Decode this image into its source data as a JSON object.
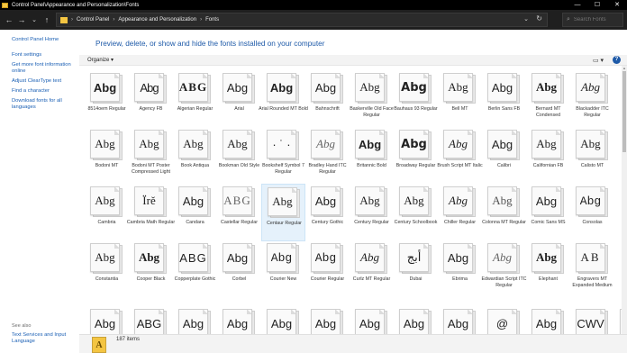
{
  "titlebar": {
    "title": "Control Panel\\Appearance and Personalization\\Fonts",
    "minimize": "—",
    "maximize": "☐",
    "close": "✕"
  },
  "nav": {
    "back": "←",
    "forward": "→",
    "recent": "⌄",
    "up": "↑",
    "breadcrumb": [
      "Control Panel",
      "Appearance and Personalization",
      "Fonts"
    ],
    "separator": "›",
    "dropdown": "⌄",
    "refresh": "↻",
    "search_placeholder": "Search Fonts",
    "search_icon": "⌕"
  },
  "leftpane": {
    "links": [
      "Control Panel Home",
      "Font settings",
      "Get more font information online",
      "Adjust ClearType text",
      "Find a character",
      "Download fonts for all languages"
    ],
    "see_also": "See also",
    "see_also_links": [
      "Text Services and Input Language"
    ]
  },
  "main": {
    "heading": "Preview, delete, or show and hide the fonts installed on your computer",
    "organize": "Organize ▾",
    "view_icon": "▭ ▾",
    "help": "?"
  },
  "fonts": [
    {
      "name": "8514oem Regular",
      "sample": "Abg"
    },
    {
      "name": "Agency FB",
      "sample": "Abg"
    },
    {
      "name": "Algerian Regular",
      "sample": "ABG"
    },
    {
      "name": "Arial",
      "sample": "Abg"
    },
    {
      "name": "Arial Rounded MT Bold",
      "sample": "Abg"
    },
    {
      "name": "Bahnschrift",
      "sample": "Abg"
    },
    {
      "name": "Baskerville Old Face Regular",
      "sample": "Abg"
    },
    {
      "name": "Bauhaus 93 Regular",
      "sample": "Abg"
    },
    {
      "name": "Bell MT",
      "sample": "Abg"
    },
    {
      "name": "Berlin Sans FB",
      "sample": "Abg"
    },
    {
      "name": "Bernard MT Condensed",
      "sample": "Abg"
    },
    {
      "name": "Blackadder ITC Regular",
      "sample": "Abg"
    },
    {
      "name": "Bodoni MT",
      "sample": "Abg"
    },
    {
      "name": "Bodoni MT Poster Compressed Light",
      "sample": "Abg"
    },
    {
      "name": "Book Antiqua",
      "sample": "Abg"
    },
    {
      "name": "Bookman Old Style",
      "sample": "Abg"
    },
    {
      "name": "Bookshelf Symbol 7 Regular",
      "sample": "· ˙ ·"
    },
    {
      "name": "Bradley Hand ITC Regular",
      "sample": "Abg"
    },
    {
      "name": "Britannic Bold",
      "sample": "Abg"
    },
    {
      "name": "Broadway Regular",
      "sample": "Abg"
    },
    {
      "name": "Brush Script MT Italic",
      "sample": "Abg"
    },
    {
      "name": "Calibri",
      "sample": "Abg"
    },
    {
      "name": "Californian FB",
      "sample": "Abg"
    },
    {
      "name": "Calisto MT",
      "sample": "Abg"
    },
    {
      "name": "Cambria",
      "sample": "Abg"
    },
    {
      "name": "Cambria Math Regular",
      "sample": "Ïrě"
    },
    {
      "name": "Candara",
      "sample": "Abg"
    },
    {
      "name": "Castellar Regular",
      "sample": "ABG"
    },
    {
      "name": "Centaur Regular",
      "sample": "Abg"
    },
    {
      "name": "Century Gothic",
      "sample": "Abg"
    },
    {
      "name": "Century Regular",
      "sample": "Abg"
    },
    {
      "name": "Century Schoolbook",
      "sample": "Abg"
    },
    {
      "name": "Chiller Regular",
      "sample": "Abg"
    },
    {
      "name": "Colonna MT Regular",
      "sample": "Abg"
    },
    {
      "name": "Comic Sans MS",
      "sample": "Abg"
    },
    {
      "name": "Consolas",
      "sample": "Abg"
    },
    {
      "name": "Constantia",
      "sample": "Abg"
    },
    {
      "name": "Cooper Black",
      "sample": "Abg"
    },
    {
      "name": "Copperplate Gothic",
      "sample": "ABG"
    },
    {
      "name": "Corbel",
      "sample": "Abg"
    },
    {
      "name": "Courier New",
      "sample": "Abg"
    },
    {
      "name": "Courier Regular",
      "sample": "Abg"
    },
    {
      "name": "Curlz MT Regular",
      "sample": "Abg"
    },
    {
      "name": "Dubai",
      "sample": "أبج"
    },
    {
      "name": "Ebrima",
      "sample": "Abg"
    },
    {
      "name": "Edwardian Script ITC Regular",
      "sample": "Abg"
    },
    {
      "name": "Elephant",
      "sample": "Abg"
    },
    {
      "name": "Engravers MT Expanded Medium",
      "sample": "AB"
    }
  ],
  "partial_row": [
    "Abg",
    "ABG",
    "Abg",
    "Abg",
    "Abg",
    "Abg",
    "Abg",
    "Abg",
    "Abg",
    "@",
    "Abg",
    "CWV",
    "Abg"
  ],
  "details": {
    "icon": "A",
    "count": "187 items"
  }
}
